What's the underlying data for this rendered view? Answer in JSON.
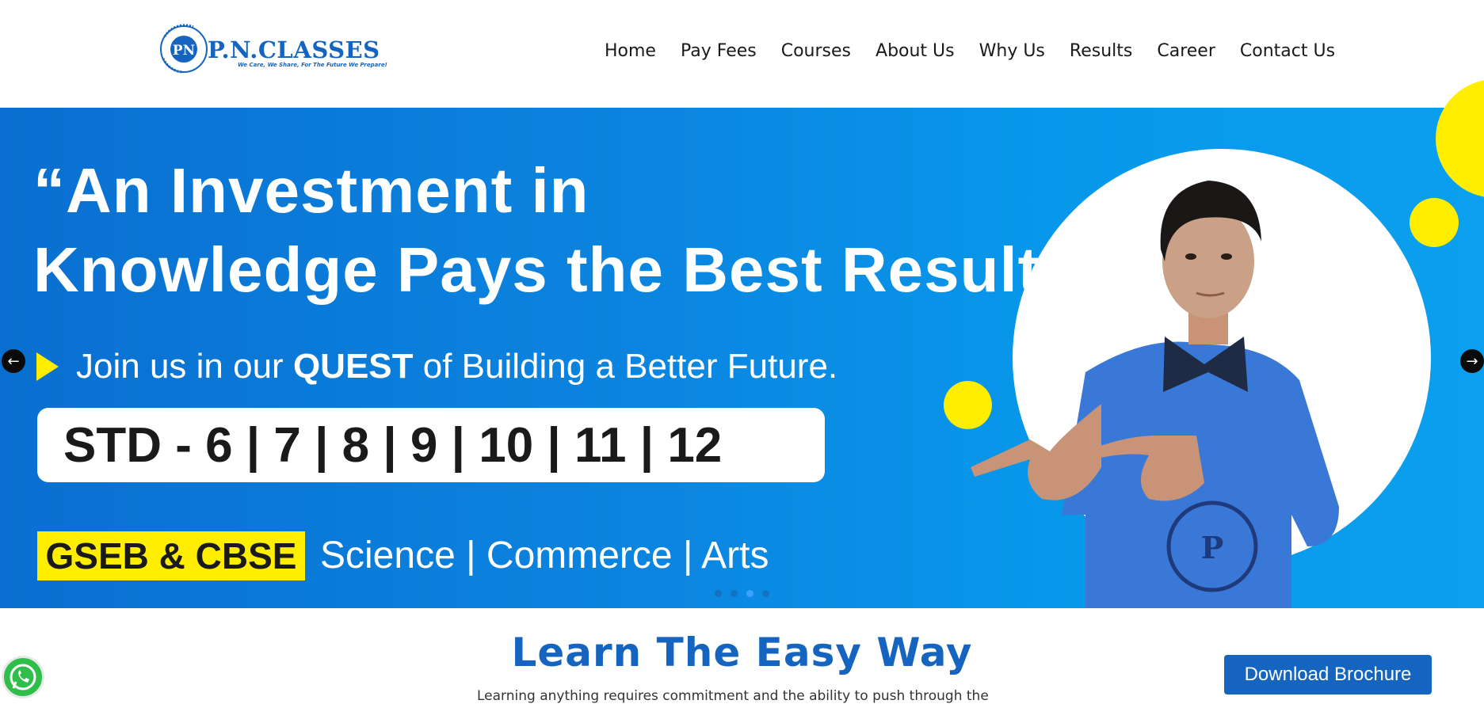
{
  "header": {
    "logo_text": "P.N.CLASSES",
    "logo_tagline": "We Care, We Share, For The Future We Prepare!",
    "logo_ring_text": "PERSONAL NURTURING CLASSES",
    "nav": [
      "Home",
      "Pay Fees",
      "Courses",
      "About Us",
      "Why Us",
      "Results",
      "Career",
      "Contact Us"
    ]
  },
  "hero": {
    "headline_line1": "“An Investment in",
    "headline_line2": "Knowledge Pays the Best Result”",
    "tagline_pre": "Join us in our ",
    "tagline_bold": "QUEST",
    "tagline_post": " of Building a Better Future.",
    "std": "STD - 6 | 7 | 8 | 9 | 10 | 11 | 12",
    "board": "GSEB & CBSE",
    "streams": "Science | Commerce | Arts",
    "prev_icon": "arrow-left-icon",
    "next_icon": "arrow-right-icon",
    "slides": 4,
    "active_slide": 3
  },
  "section": {
    "title": "Learn The Easy Way",
    "subtitle": "Learning anything requires commitment and the ability to push through the",
    "brochure_label": "Download Brochure"
  },
  "floating": {
    "whatsapp_icon": "whatsapp-icon"
  },
  "colors": {
    "brand_blue": "#1565c0",
    "accent_yellow": "#ffee00",
    "hero_blue": "#0b86e0"
  }
}
